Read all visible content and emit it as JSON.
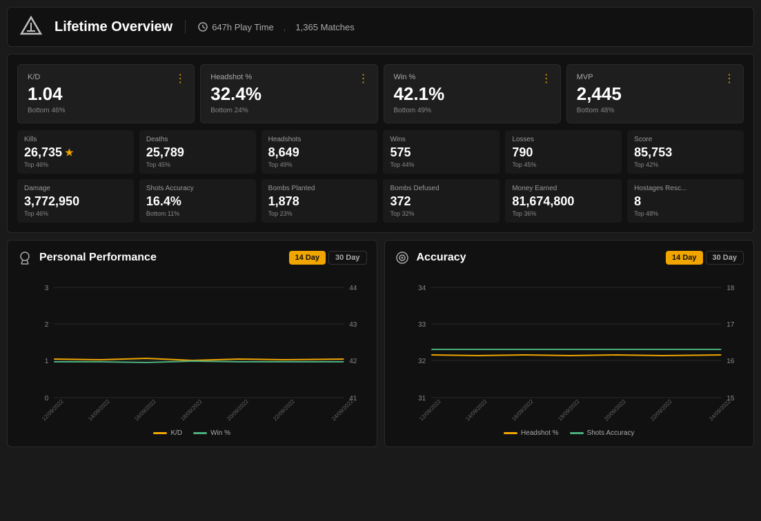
{
  "header": {
    "title": "Lifetime Overview",
    "play_time": "647h Play Time",
    "matches": "1,365 Matches"
  },
  "big_stats": [
    {
      "label": "K/D",
      "value": "1.04",
      "sub": "Bottom 46%",
      "id": "kd"
    },
    {
      "label": "Headshot %",
      "value": "32.4%",
      "sub": "Bottom 24%",
      "id": "headshot-pct"
    },
    {
      "label": "Win %",
      "value": "42.1%",
      "sub": "Bottom 49%",
      "id": "win-pct"
    },
    {
      "label": "MVP",
      "value": "2,445",
      "sub": "Bottom 48%",
      "id": "mvp"
    }
  ],
  "small_stats_row1": [
    {
      "label": "Kills",
      "value": "26,735",
      "sub": "Top 46%",
      "star": true
    },
    {
      "label": "Deaths",
      "value": "25,789",
      "sub": "Top 45%",
      "star": false
    },
    {
      "label": "Headshots",
      "value": "8,649",
      "sub": "Top 49%",
      "star": false
    },
    {
      "label": "Wins",
      "value": "575",
      "sub": "Top 44%",
      "star": false
    },
    {
      "label": "Losses",
      "value": "790",
      "sub": "Top 45%",
      "star": false
    },
    {
      "label": "Score",
      "value": "85,753",
      "sub": "Top 42%",
      "star": false
    }
  ],
  "small_stats_row2": [
    {
      "label": "Damage",
      "value": "3,772,950",
      "sub": "Top 46%",
      "star": false
    },
    {
      "label": "Shots Accuracy",
      "value": "16.4%",
      "sub": "Bottom 11%",
      "star": false
    },
    {
      "label": "Bombs Planted",
      "value": "1,878",
      "sub": "Top 23%",
      "star": false
    },
    {
      "label": "Bombs Defused",
      "value": "372",
      "sub": "Top 32%",
      "star": false
    },
    {
      "label": "Money Earned",
      "value": "81,674,800",
      "sub": "Top 36%",
      "star": false
    },
    {
      "label": "Hostages Resc...",
      "value": "8",
      "sub": "Top 48%",
      "star": false
    }
  ],
  "perf_chart": {
    "title": "Personal Performance",
    "day_buttons": [
      "14 Day",
      "30 Day"
    ],
    "active_btn": 0,
    "y_left_labels": [
      "3",
      "2",
      "1",
      "0"
    ],
    "y_right_labels": [
      "44",
      "43",
      "42",
      "41"
    ],
    "x_labels": [
      "12/09/2022",
      "14/09/2022",
      "16/09/2022",
      "18/09/2022",
      "20/09/2022",
      "22/09/2022",
      "24/09/2022"
    ],
    "legend": [
      {
        "label": "K/D",
        "color": "#f0a500"
      },
      {
        "label": "Win %",
        "color": "#4caf7d"
      }
    ]
  },
  "accuracy_chart": {
    "title": "Accuracy",
    "day_buttons": [
      "14 Day",
      "30 Day"
    ],
    "active_btn": 0,
    "y_left_labels": [
      "34",
      "33",
      "32",
      "31"
    ],
    "y_right_labels": [
      "18",
      "17",
      "16",
      "15"
    ],
    "x_labels": [
      "12/09/2022",
      "14/09/2022",
      "16/09/2022",
      "18/09/2022",
      "20/09/2022",
      "22/09/2022",
      "24/09/2022"
    ],
    "legend": [
      {
        "label": "Headshot %",
        "color": "#f0a500"
      },
      {
        "label": "Shots Accuracy",
        "color": "#4caf7d"
      }
    ]
  }
}
